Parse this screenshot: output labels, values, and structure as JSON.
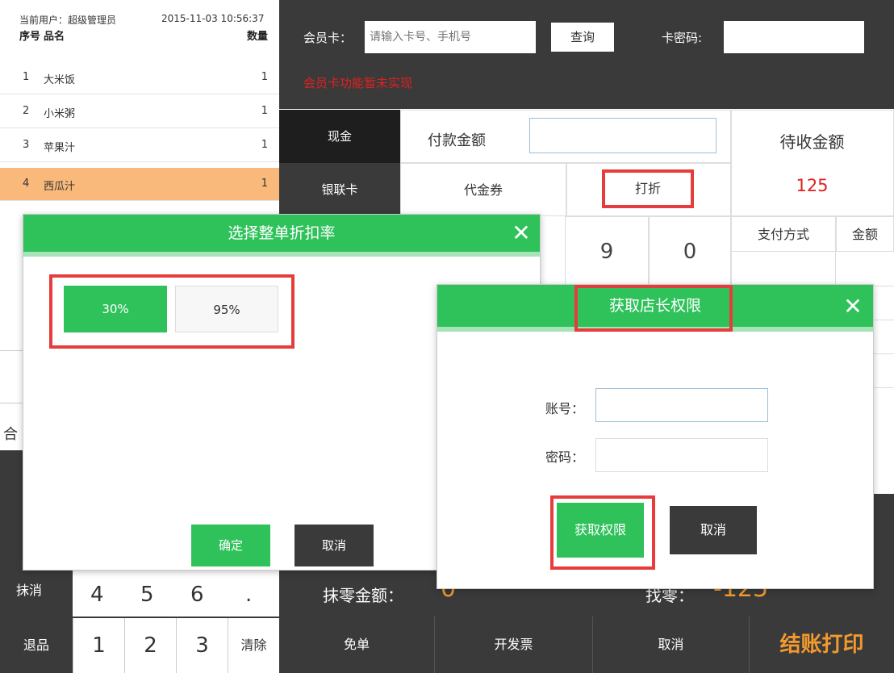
{
  "header": {
    "current_user": "当前用户：超级管理员",
    "datetime": "2015-11-03 10:56:37"
  },
  "order_table": {
    "col_no": "序号",
    "col_name": "品名",
    "col_qty": "数量",
    "rows": [
      {
        "no": "1",
        "name": "大米饭",
        "qty": "1"
      },
      {
        "no": "2",
        "name": "小米粥",
        "qty": "1"
      },
      {
        "no": "3",
        "name": "苹果汁",
        "qty": "1"
      },
      {
        "no": "4",
        "name": "西瓜汁",
        "qty": "1"
      }
    ],
    "selected_row": 4
  },
  "member": {
    "card_label": "会员卡：",
    "card_placeholder": "请输入卡号、手机号",
    "query_button": "查询",
    "password_label": "卡密码:",
    "warning": "会员卡功能暂未实现"
  },
  "payment": {
    "cash": "现金",
    "pay_amount_label": "付款金额",
    "unionpay": "银联卡",
    "voucher": "代金券",
    "discount": "打折",
    "pending_label": "待收金额",
    "pending_value": "125",
    "digit_9": "9",
    "digit_0": "0",
    "col_method": "支付方式",
    "col_amount": "金额"
  },
  "keypad": {
    "left_partial": "抹消",
    "refund": "退品",
    "key_1": "1",
    "key_2": "2",
    "key_3": "3",
    "clear": "清除",
    "partial_row": [
      "4",
      "5",
      "6",
      "."
    ],
    "total_partial": "合"
  },
  "bottom": {
    "free": "免单",
    "invoice": "开发票",
    "cancel": "取消",
    "checkout": "结账打印",
    "zero_label": "抹零金额：",
    "zero_value": "0",
    "change_label": "找零：",
    "change_value": "-125"
  },
  "discount_dialog": {
    "title": "选择整单折扣率",
    "close": "✕",
    "rates": [
      "30%",
      "95%"
    ],
    "selected_rate": "30%",
    "ok": "确定",
    "cancel": "取消"
  },
  "auth_dialog": {
    "title": "获取店长权限",
    "close": "✕",
    "account_label": "账号：",
    "password_label": "密码：",
    "submit": "获取权限",
    "cancel": "取消"
  },
  "colors": {
    "green": "#2fc25b",
    "dark": "#3b3a3a",
    "orange": "#f29a2e",
    "red": "#e02020",
    "highlight": "#e63c3c",
    "selected_row": "#f9b97a"
  }
}
